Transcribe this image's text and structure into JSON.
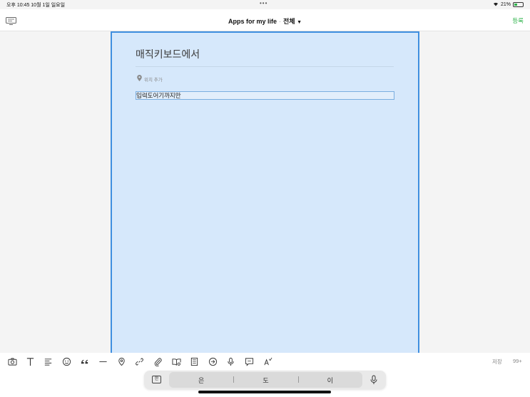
{
  "status_bar": {
    "time_date": "오후 10:45   10월 1일 일요일",
    "dots": "•••",
    "battery": "21%"
  },
  "nav": {
    "title": "Apps for my life",
    "separator": "·",
    "scope": "전체",
    "dropdown_glyph": "▼",
    "action": "등록"
  },
  "editor": {
    "title": "매직키보드에서",
    "location_placeholder": "위치 추가",
    "body_text": "입력도어기까지만"
  },
  "toolbar": {
    "icons": [
      "camera-icon",
      "text-icon",
      "align-icon",
      "emoji-icon",
      "quote-icon",
      "divider-icon",
      "location-icon",
      "link-icon",
      "attachment-icon",
      "map-icon",
      "template-icon",
      "sticker-icon",
      "mic-icon",
      "comment-icon",
      "spellcheck-icon"
    ],
    "save_label": "저장",
    "count_label": "99+"
  },
  "keyboard": {
    "ime_label": "한",
    "suggestions": [
      "은",
      "도",
      "이"
    ]
  },
  "colors": {
    "accent_green": "#2db34a",
    "editor_border": "#3f8fe0",
    "editor_bg": "#d6e8fb"
  }
}
